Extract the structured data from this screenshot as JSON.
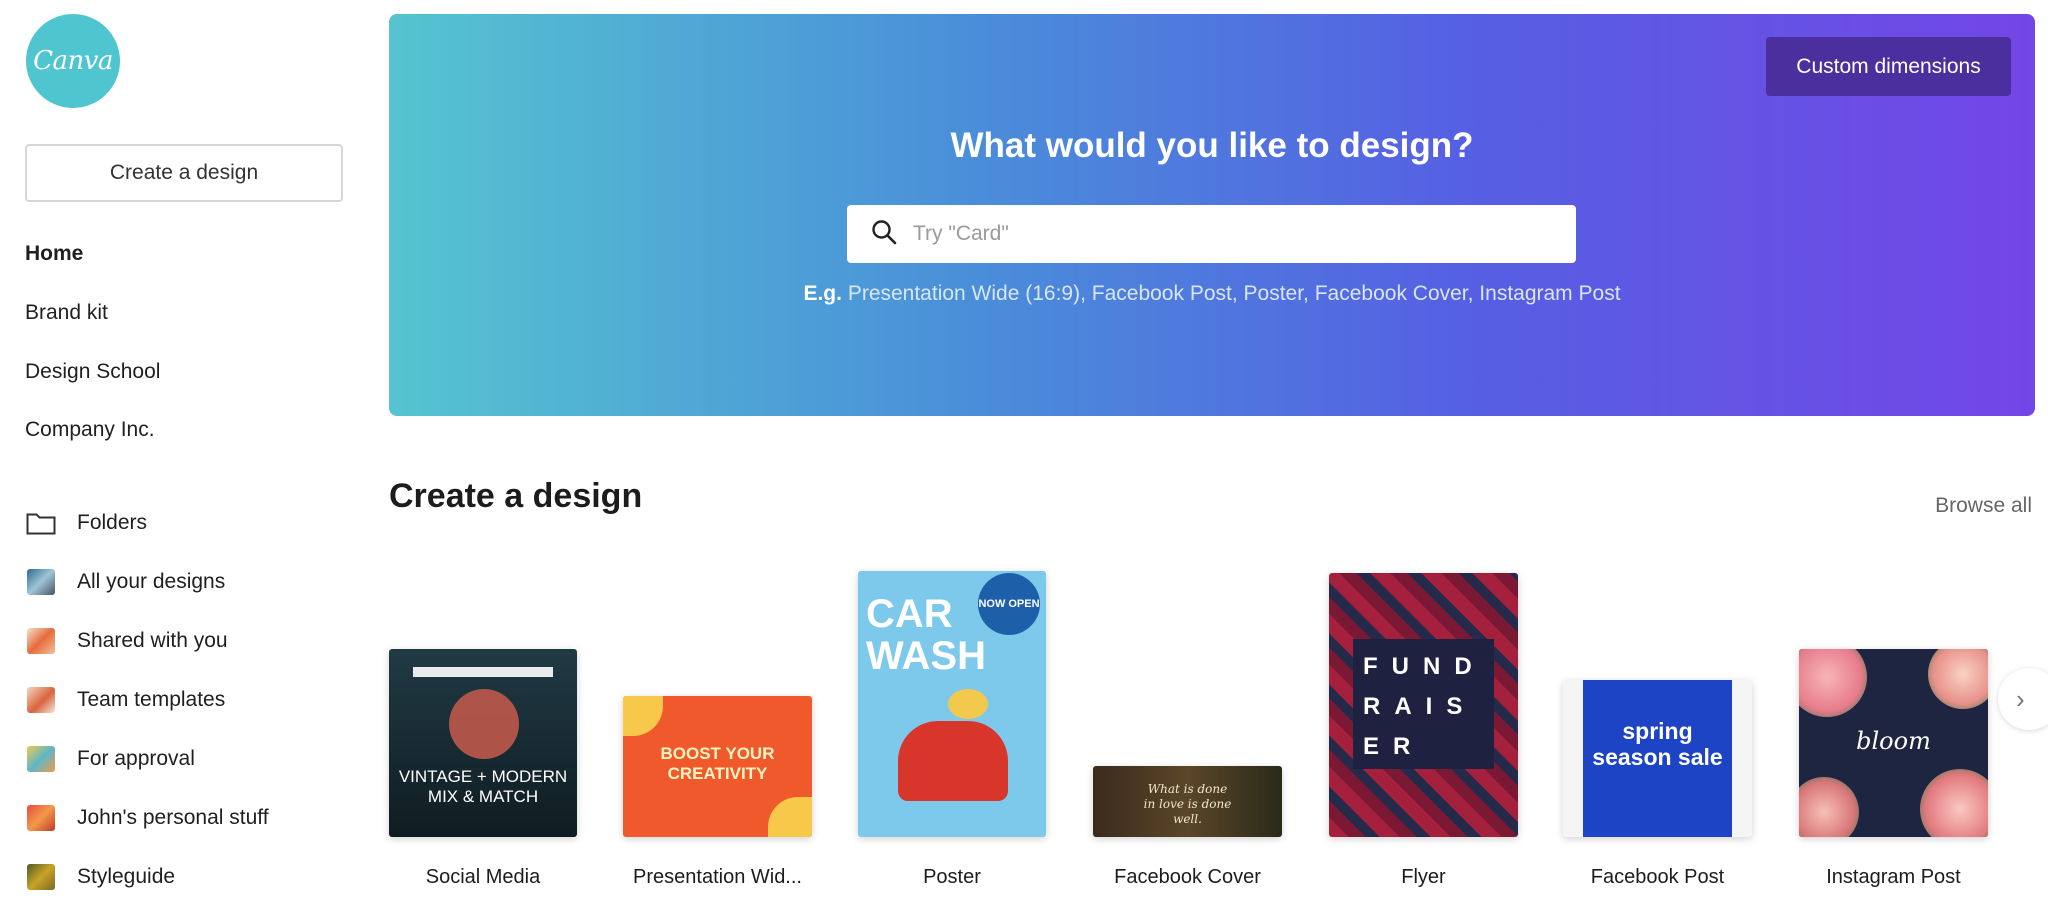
{
  "logo": {
    "text": "Canva",
    "color": "#4ec5cf"
  },
  "sidebar": {
    "create_button": "Create a design",
    "nav": [
      {
        "label": "Home",
        "active": true
      },
      {
        "label": "Brand kit"
      },
      {
        "label": "Design School"
      },
      {
        "label": "Company Inc."
      }
    ],
    "folders": [
      {
        "label": "Folders",
        "icon": "folder-icon"
      },
      {
        "label": "All your designs",
        "icon": "thumbnail-icon"
      },
      {
        "label": "Shared with you",
        "icon": "thumbnail-icon"
      },
      {
        "label": "Team templates",
        "icon": "thumbnail-icon"
      },
      {
        "label": "For approval",
        "icon": "thumbnail-icon"
      },
      {
        "label": "John's personal stuff",
        "icon": "thumbnail-icon"
      },
      {
        "label": "Styleguide",
        "icon": "thumbnail-icon"
      }
    ]
  },
  "hero": {
    "custom_dimensions": "Custom dimensions",
    "title": "What would you like to design?",
    "search_placeholder": "Try \"Card\"",
    "examples_prefix": "E.g.",
    "examples": "Presentation Wide (16:9), Facebook Post, Poster, Facebook Cover, Instagram Post"
  },
  "section": {
    "title": "Create a design",
    "browse_all": "Browse all",
    "cards": [
      {
        "label": "Social Media",
        "thumb_text": "VINTAGE + MODERN MIX & MATCH"
      },
      {
        "label": "Presentation Wid...",
        "thumb_text": "BOOST YOUR CREATIVITY"
      },
      {
        "label": "Poster",
        "thumb_text": "CAR WASH",
        "thumb_sub": "NOW OPEN"
      },
      {
        "label": "Facebook Cover",
        "thumb_text": "What is done in love is done well."
      },
      {
        "label": "Flyer",
        "thumb_text": "FUND RAIS ER"
      },
      {
        "label": "Facebook Post",
        "thumb_text": "spring season sale"
      },
      {
        "label": "Instagram Post",
        "thumb_text": "bloom"
      }
    ]
  },
  "colors": {
    "hero_start": "#55c4d0",
    "hero_end": "#7346e6",
    "custom_button": "#4b2f9e"
  }
}
